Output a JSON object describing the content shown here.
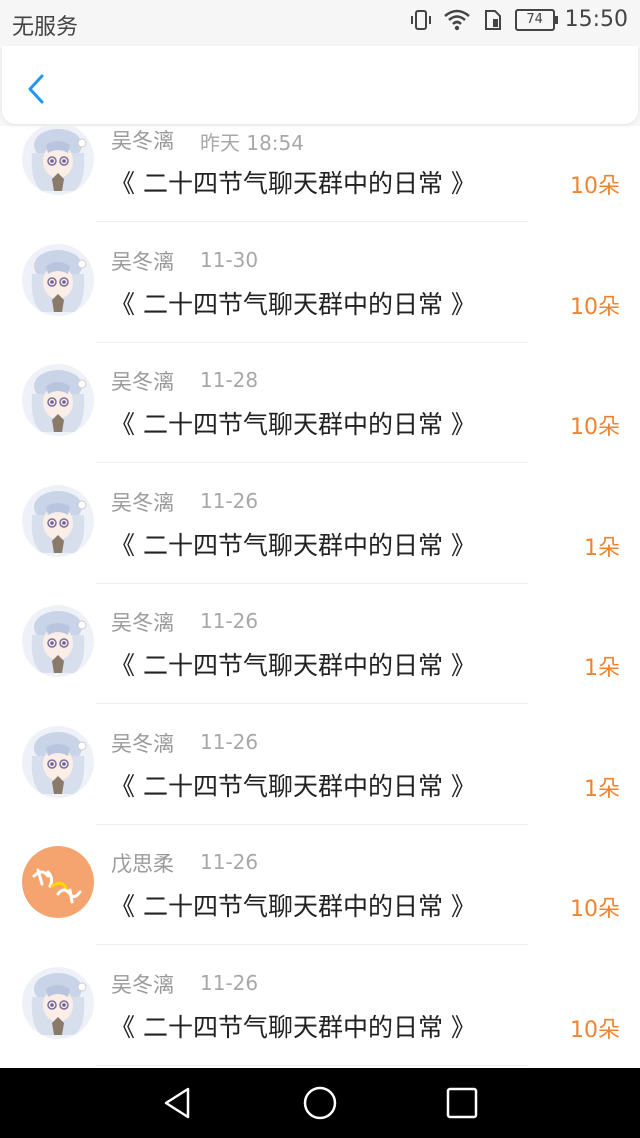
{
  "status_bar": {
    "carrier": "无服务",
    "battery": "74",
    "time": "15:50"
  },
  "header": {
    "back_icon": "chevron-left-icon",
    "accent_color": "#2196f3"
  },
  "list": {
    "items": [
      {
        "name": "吴冬漓",
        "date": "昨天 18:54",
        "title": "《 二十四节气聊天群中的日常 》",
        "amount": "10朵",
        "avatar": "anime-girl"
      },
      {
        "name": "吴冬漓",
        "date": "11-30",
        "title": "《 二十四节气聊天群中的日常 》",
        "amount": "10朵",
        "avatar": "anime-girl"
      },
      {
        "name": "吴冬漓",
        "date": "11-28",
        "title": "《 二十四节气聊天群中的日常 》",
        "amount": "10朵",
        "avatar": "anime-girl"
      },
      {
        "name": "吴冬漓",
        "date": "11-26",
        "title": "《 二十四节气聊天群中的日常 》",
        "amount": "1朵",
        "avatar": "anime-girl"
      },
      {
        "name": "吴冬漓",
        "date": "11-26",
        "title": "《 二十四节气聊天群中的日常 》",
        "amount": "1朵",
        "avatar": "anime-girl"
      },
      {
        "name": "吴冬漓",
        "date": "11-26",
        "title": "《 二十四节气聊天群中的日常 》",
        "amount": "1朵",
        "avatar": "anime-girl"
      },
      {
        "name": "戊思柔",
        "date": "11-26",
        "title": "《 二十四节气聊天群中的日常 》",
        "amount": "10朵",
        "avatar": "orange-calligraphy"
      },
      {
        "name": "吴冬漓",
        "date": "11-26",
        "title": "《 二十四节气聊天群中的日常 》",
        "amount": "10朵",
        "avatar": "anime-girl"
      }
    ]
  },
  "nav_bar": {
    "back": "triangle-back-icon",
    "home": "circle-home-icon",
    "recents": "square-recents-icon"
  }
}
